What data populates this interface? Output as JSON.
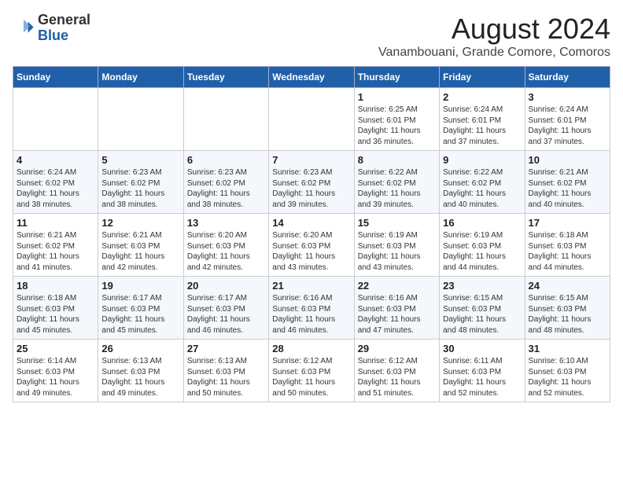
{
  "header": {
    "logo_general": "General",
    "logo_blue": "Blue",
    "month_year": "August 2024",
    "location": "Vanambouani, Grande Comore, Comoros"
  },
  "days_of_week": [
    "Sunday",
    "Monday",
    "Tuesday",
    "Wednesday",
    "Thursday",
    "Friday",
    "Saturday"
  ],
  "weeks": [
    [
      {
        "day": "",
        "info": ""
      },
      {
        "day": "",
        "info": ""
      },
      {
        "day": "",
        "info": ""
      },
      {
        "day": "",
        "info": ""
      },
      {
        "day": "1",
        "info": "Sunrise: 6:25 AM\nSunset: 6:01 PM\nDaylight: 11 hours\nand 36 minutes."
      },
      {
        "day": "2",
        "info": "Sunrise: 6:24 AM\nSunset: 6:01 PM\nDaylight: 11 hours\nand 37 minutes."
      },
      {
        "day": "3",
        "info": "Sunrise: 6:24 AM\nSunset: 6:01 PM\nDaylight: 11 hours\nand 37 minutes."
      }
    ],
    [
      {
        "day": "4",
        "info": "Sunrise: 6:24 AM\nSunset: 6:02 PM\nDaylight: 11 hours\nand 38 minutes."
      },
      {
        "day": "5",
        "info": "Sunrise: 6:23 AM\nSunset: 6:02 PM\nDaylight: 11 hours\nand 38 minutes."
      },
      {
        "day": "6",
        "info": "Sunrise: 6:23 AM\nSunset: 6:02 PM\nDaylight: 11 hours\nand 38 minutes."
      },
      {
        "day": "7",
        "info": "Sunrise: 6:23 AM\nSunset: 6:02 PM\nDaylight: 11 hours\nand 39 minutes."
      },
      {
        "day": "8",
        "info": "Sunrise: 6:22 AM\nSunset: 6:02 PM\nDaylight: 11 hours\nand 39 minutes."
      },
      {
        "day": "9",
        "info": "Sunrise: 6:22 AM\nSunset: 6:02 PM\nDaylight: 11 hours\nand 40 minutes."
      },
      {
        "day": "10",
        "info": "Sunrise: 6:21 AM\nSunset: 6:02 PM\nDaylight: 11 hours\nand 40 minutes."
      }
    ],
    [
      {
        "day": "11",
        "info": "Sunrise: 6:21 AM\nSunset: 6:02 PM\nDaylight: 11 hours\nand 41 minutes."
      },
      {
        "day": "12",
        "info": "Sunrise: 6:21 AM\nSunset: 6:03 PM\nDaylight: 11 hours\nand 42 minutes."
      },
      {
        "day": "13",
        "info": "Sunrise: 6:20 AM\nSunset: 6:03 PM\nDaylight: 11 hours\nand 42 minutes."
      },
      {
        "day": "14",
        "info": "Sunrise: 6:20 AM\nSunset: 6:03 PM\nDaylight: 11 hours\nand 43 minutes."
      },
      {
        "day": "15",
        "info": "Sunrise: 6:19 AM\nSunset: 6:03 PM\nDaylight: 11 hours\nand 43 minutes."
      },
      {
        "day": "16",
        "info": "Sunrise: 6:19 AM\nSunset: 6:03 PM\nDaylight: 11 hours\nand 44 minutes."
      },
      {
        "day": "17",
        "info": "Sunrise: 6:18 AM\nSunset: 6:03 PM\nDaylight: 11 hours\nand 44 minutes."
      }
    ],
    [
      {
        "day": "18",
        "info": "Sunrise: 6:18 AM\nSunset: 6:03 PM\nDaylight: 11 hours\nand 45 minutes."
      },
      {
        "day": "19",
        "info": "Sunrise: 6:17 AM\nSunset: 6:03 PM\nDaylight: 11 hours\nand 45 minutes."
      },
      {
        "day": "20",
        "info": "Sunrise: 6:17 AM\nSunset: 6:03 PM\nDaylight: 11 hours\nand 46 minutes."
      },
      {
        "day": "21",
        "info": "Sunrise: 6:16 AM\nSunset: 6:03 PM\nDaylight: 11 hours\nand 46 minutes."
      },
      {
        "day": "22",
        "info": "Sunrise: 6:16 AM\nSunset: 6:03 PM\nDaylight: 11 hours\nand 47 minutes."
      },
      {
        "day": "23",
        "info": "Sunrise: 6:15 AM\nSunset: 6:03 PM\nDaylight: 11 hours\nand 48 minutes."
      },
      {
        "day": "24",
        "info": "Sunrise: 6:15 AM\nSunset: 6:03 PM\nDaylight: 11 hours\nand 48 minutes."
      }
    ],
    [
      {
        "day": "25",
        "info": "Sunrise: 6:14 AM\nSunset: 6:03 PM\nDaylight: 11 hours\nand 49 minutes."
      },
      {
        "day": "26",
        "info": "Sunrise: 6:13 AM\nSunset: 6:03 PM\nDaylight: 11 hours\nand 49 minutes."
      },
      {
        "day": "27",
        "info": "Sunrise: 6:13 AM\nSunset: 6:03 PM\nDaylight: 11 hours\nand 50 minutes."
      },
      {
        "day": "28",
        "info": "Sunrise: 6:12 AM\nSunset: 6:03 PM\nDaylight: 11 hours\nand 50 minutes."
      },
      {
        "day": "29",
        "info": "Sunrise: 6:12 AM\nSunset: 6:03 PM\nDaylight: 11 hours\nand 51 minutes."
      },
      {
        "day": "30",
        "info": "Sunrise: 6:11 AM\nSunset: 6:03 PM\nDaylight: 11 hours\nand 52 minutes."
      },
      {
        "day": "31",
        "info": "Sunrise: 6:10 AM\nSunset: 6:03 PM\nDaylight: 11 hours\nand 52 minutes."
      }
    ]
  ]
}
